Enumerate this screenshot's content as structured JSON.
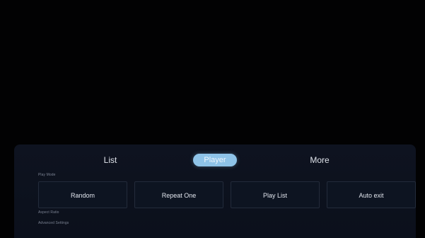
{
  "tabs": {
    "list": "List",
    "player": "Player",
    "more": "More"
  },
  "sections": {
    "play_mode": "Play Mode",
    "aspect_ratio": "Aspect Ratio",
    "advanced_settings": "Advanced Settings"
  },
  "play_mode_options": [
    "Random",
    "Repeat One",
    "Play List",
    "Auto exit"
  ],
  "colors": {
    "background": "#020203",
    "panel": "#0e1320",
    "active_tab": "#8ec3e8",
    "text": "#e2e6ee"
  }
}
